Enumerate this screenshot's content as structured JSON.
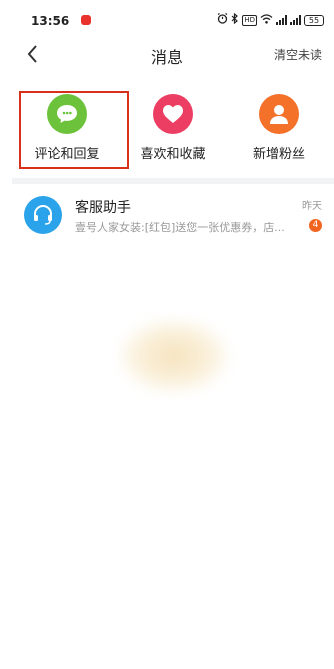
{
  "status_bar": {
    "time": "13:56",
    "hd_label": "HD",
    "battery": "55"
  },
  "header": {
    "title": "消息",
    "clear_unread": "清空未读"
  },
  "categories": [
    {
      "label": "评论和回复",
      "icon": "comment-icon",
      "color": "#6cc33b"
    },
    {
      "label": "喜欢和收藏",
      "icon": "heart-icon",
      "color": "#ec3d63"
    },
    {
      "label": "新增粉丝",
      "icon": "user-icon",
      "color": "#f4712a"
    }
  ],
  "messages": [
    {
      "name": "客服助手",
      "preview": "壹号人家女装:[红包]送您一张优惠券，店...",
      "time": "昨天",
      "unread": "4",
      "icon": "headset-icon",
      "avatar_color": "#2aa3ea"
    }
  ],
  "colors": {
    "highlight": "#d9301b",
    "badge": "#f0641f"
  }
}
